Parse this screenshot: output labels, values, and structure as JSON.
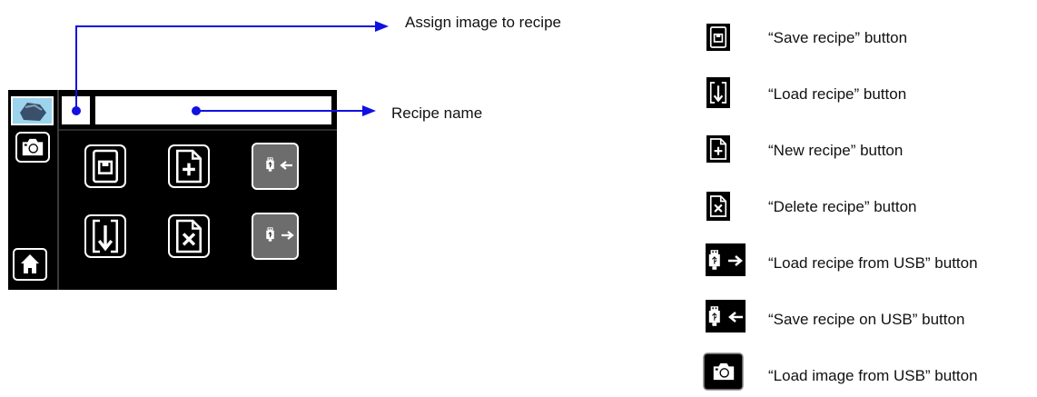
{
  "callouts": {
    "assign_image": "Assign image to recipe",
    "recipe_name": "Recipe name"
  },
  "legend": [
    {
      "icon": "save-recipe-icon",
      "label": "“Save recipe” button"
    },
    {
      "icon": "load-recipe-icon",
      "label": "“Load recipe” button"
    },
    {
      "icon": "new-recipe-icon",
      "label": "“New recipe” button"
    },
    {
      "icon": "delete-recipe-icon",
      "label": "“Delete recipe” button"
    },
    {
      "icon": "usb-load-icon",
      "label": "“Load recipe from USB” button"
    },
    {
      "icon": "usb-save-icon",
      "label": "“Save recipe on USB” button"
    },
    {
      "icon": "camera-icon",
      "label": "“Load image from USB” button"
    }
  ],
  "colors": {
    "arrow": "#1010e0",
    "screen": "#000000",
    "button_gray": "#6d6d6d",
    "white": "#ffffff"
  }
}
